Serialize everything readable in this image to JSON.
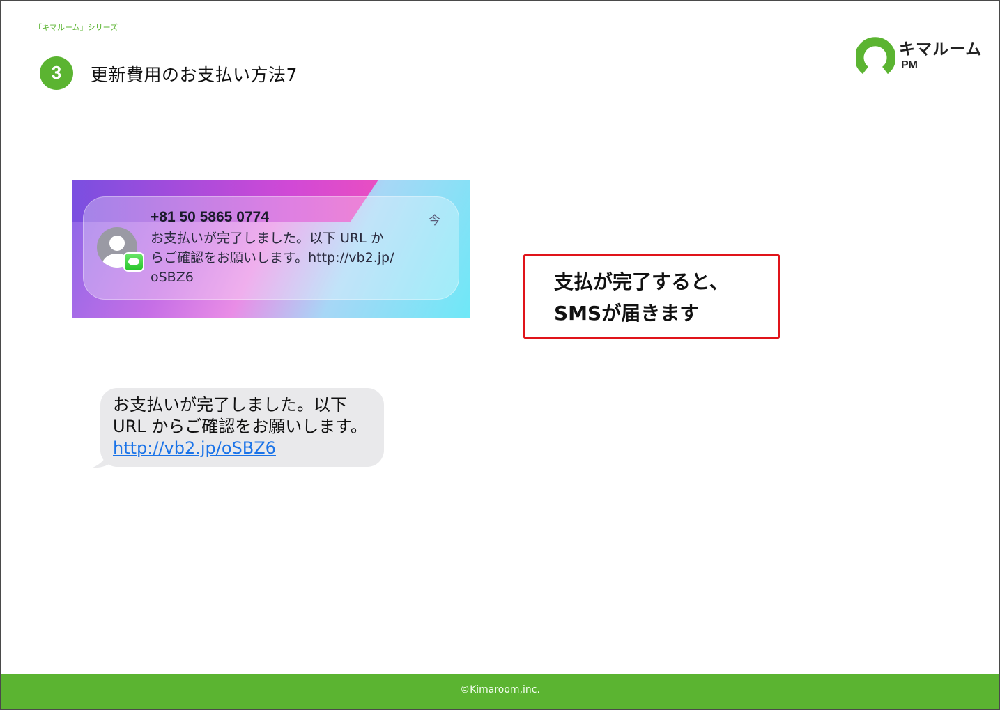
{
  "header": {
    "series_label": "「キマルーム」シリーズ",
    "step_number": "3",
    "title": "更新費用のお支払い方法7"
  },
  "logo": {
    "name": "キマルーム",
    "sub": "PM",
    "brand_color": "#5bb431"
  },
  "notification": {
    "sender": "+81 50 5865 0774",
    "time": "今",
    "body_lines": [
      "お支払いが完了しました。以下 URL か",
      "らご確認をお願いします。http://vb2.jp/",
      "oSBZ6"
    ],
    "avatar_icon": "person-icon",
    "badge_icon": "messages-icon"
  },
  "callout": {
    "lines": [
      "支払が完了すると、",
      "SMSが届きます"
    ],
    "border_color": "#e0141a"
  },
  "sms": {
    "lines": [
      "お支払いが完了しました。以下",
      "URL からご確認をお願いします。"
    ],
    "link": "http://vb2.jp/oSBZ6",
    "link_color": "#1a73e8"
  },
  "footer": {
    "copyright": "©Kimaroom,inc."
  }
}
